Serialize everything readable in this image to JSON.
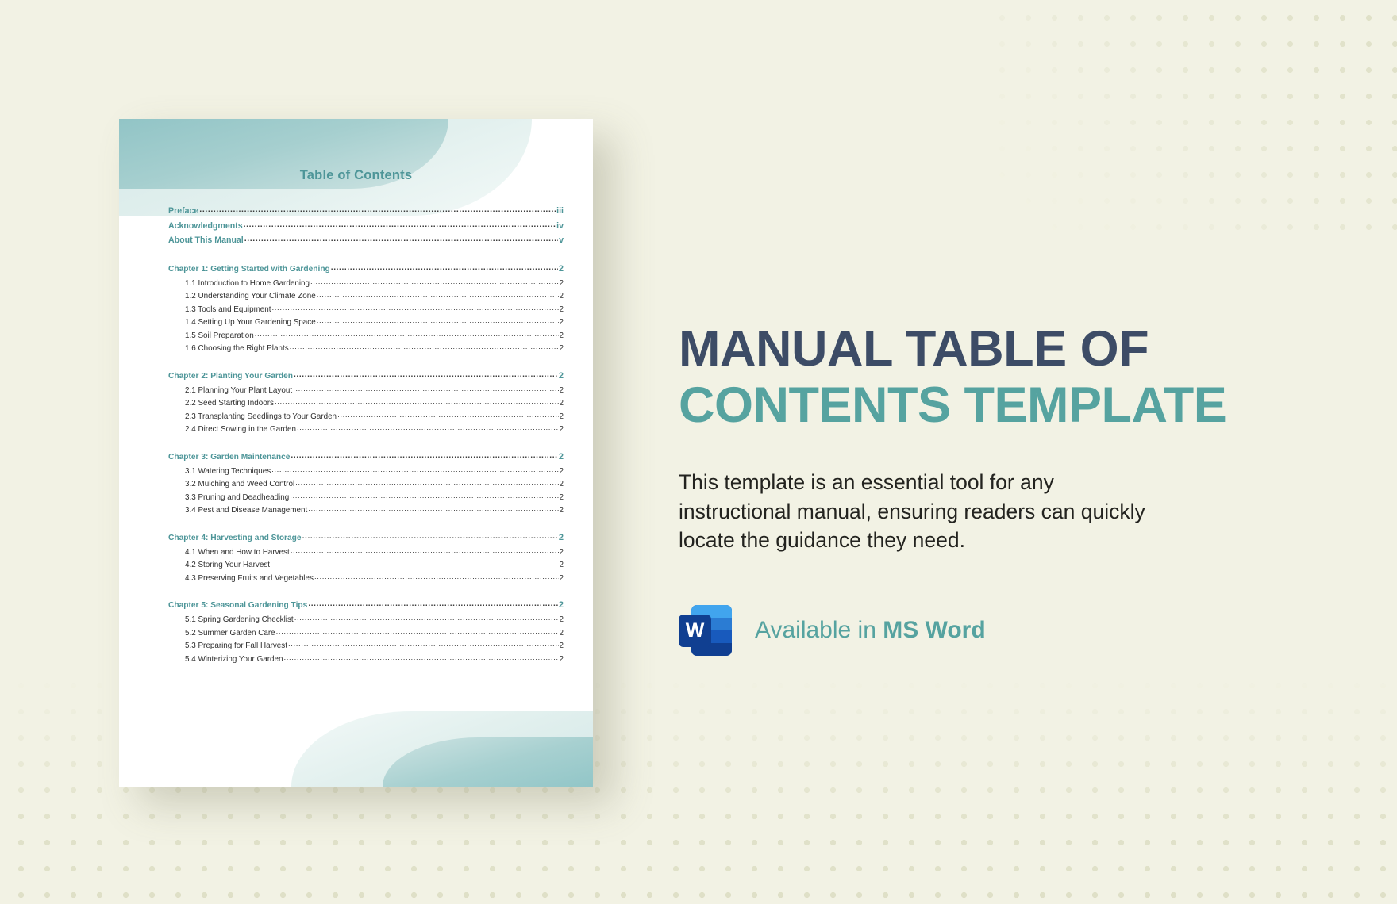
{
  "background": {
    "color": "#f2f2e4",
    "dot_color": "#dedfc5"
  },
  "document": {
    "toc_title": "Table of Contents",
    "front_matter": [
      {
        "label": "Preface",
        "page": "iii"
      },
      {
        "label": "Acknowledgments",
        "page": "iv"
      },
      {
        "label": "About This Manual",
        "page": "v"
      }
    ],
    "chapters": [
      {
        "title": "Chapter 1: Getting Started with Gardening",
        "page": "2",
        "sections": [
          {
            "label": "1.1 Introduction to Home Gardening",
            "page": "2"
          },
          {
            "label": "1.2 Understanding Your Climate Zone",
            "page": "2"
          },
          {
            "label": "1.3 Tools and Equipment",
            "page": "2"
          },
          {
            "label": "1.4 Setting Up Your Gardening Space",
            "page": "2"
          },
          {
            "label": "1.5 Soil Preparation",
            "page": "2"
          },
          {
            "label": "1.6 Choosing the Right Plants",
            "page": "2"
          }
        ]
      },
      {
        "title": "Chapter 2: Planting Your Garden",
        "page": "2",
        "sections": [
          {
            "label": "2.1 Planning Your Plant Layout",
            "page": "2"
          },
          {
            "label": "2.2 Seed Starting Indoors",
            "page": "2"
          },
          {
            "label": "2.3 Transplanting Seedlings to Your Garden",
            "page": "2"
          },
          {
            "label": "2.4 Direct Sowing in the Garden",
            "page": "2"
          }
        ]
      },
      {
        "title": "Chapter 3: Garden Maintenance",
        "page": "2",
        "sections": [
          {
            "label": "3.1 Watering Techniques",
            "page": "2"
          },
          {
            "label": "3.2 Mulching and Weed Control",
            "page": "2"
          },
          {
            "label": "3.3 Pruning and Deadheading",
            "page": "2"
          },
          {
            "label": "3.4 Pest and Disease Management",
            "page": "2"
          }
        ]
      },
      {
        "title": "Chapter 4: Harvesting and Storage",
        "page": "2",
        "sections": [
          {
            "label": "4.1 When and How to Harvest",
            "page": "2"
          },
          {
            "label": "4.2 Storing Your Harvest",
            "page": "2"
          },
          {
            "label": "4.3 Preserving Fruits and Vegetables",
            "page": "2"
          }
        ]
      },
      {
        "title": "Chapter 5: Seasonal Gardening Tips",
        "page": "2",
        "sections": [
          {
            "label": "5.1 Spring Gardening Checklist",
            "page": "2"
          },
          {
            "label": "5.2 Summer Garden Care",
            "page": "2"
          },
          {
            "label": "5.3 Preparing for Fall Harvest",
            "page": "2"
          },
          {
            "label": "5.4 Winterizing Your Garden",
            "page": "2"
          }
        ]
      }
    ]
  },
  "promo": {
    "title_line_1": "MANUAL TABLE OF",
    "title_line_2": "CONTENTS TEMPLATE",
    "title_color_1": "#3d4c66",
    "title_color_2": "#56a3a0",
    "description": "This template is an essential tool for any instructional manual, ensuring readers can quickly locate the guidance they need.",
    "availability_prefix": "Available in ",
    "availability_app": "MS Word",
    "availability_color": "#56a3a0",
    "word_icon_letter": "W"
  }
}
